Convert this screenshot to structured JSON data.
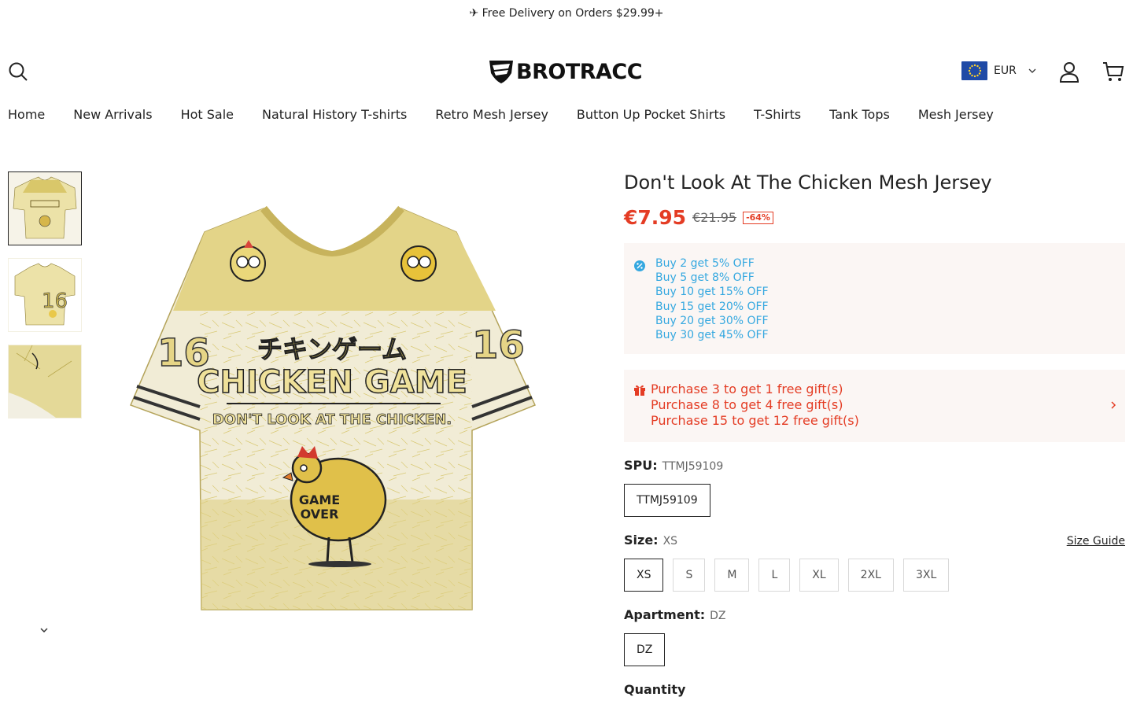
{
  "announcement": "✈ Free Delivery on Orders $29.99+",
  "brand": {
    "logo_text": "BROTRACC"
  },
  "header": {
    "currency": "EUR"
  },
  "nav": [
    "Home",
    "New Arrivals",
    "Hot Sale",
    "Natural History T-shirts",
    "Retro Mesh Jersey",
    "Button Up Pocket Shirts",
    "T-Shirts",
    "Tank Tops",
    "Mesh Jersey"
  ],
  "product": {
    "title": "Don't Look At The Chicken Mesh Jersey",
    "price": "€7.95",
    "compare_price": "€21.95",
    "discount": "-64%",
    "tiers": [
      "Buy 2 get 5% OFF",
      "Buy 5 get 8% OFF",
      "Buy 10 get 15% OFF",
      "Buy 15 get 20% OFF",
      "Buy 20 get 30% OFF",
      "Buy 30 get 45% OFF"
    ],
    "gifts": [
      "Purchase 3 to get 1 free gift(s)",
      "Purchase 8 to get 4 free gift(s)",
      "Purchase 15 to get 12 free gift(s)"
    ],
    "spu": {
      "label": "SPU:",
      "value": "TTMJ59109",
      "options": [
        "TTMJ59109"
      ]
    },
    "size": {
      "label": "Size:",
      "value": "XS",
      "options": [
        "XS",
        "S",
        "M",
        "L",
        "XL",
        "2XL",
        "3XL"
      ],
      "guide": "Size Guide"
    },
    "apartment": {
      "label": "Apartment:",
      "value": "DZ",
      "options": [
        "DZ"
      ]
    },
    "quantity_label": "Quantity"
  },
  "image": {
    "jersey_jp": "チキンゲーム",
    "jersey_main": "CHICKEN GAME",
    "jersey_sub": "DON'T LOOK AT THE CHICKEN.",
    "jersey_badge_1": "GAME",
    "jersey_badge_2": "OVER",
    "jersey_number": "16"
  },
  "colors": {
    "accent": "#e43c24",
    "tier": "#35a8e0",
    "jersey": "#e9dc95",
    "jersey_band": "#d9c76a"
  }
}
